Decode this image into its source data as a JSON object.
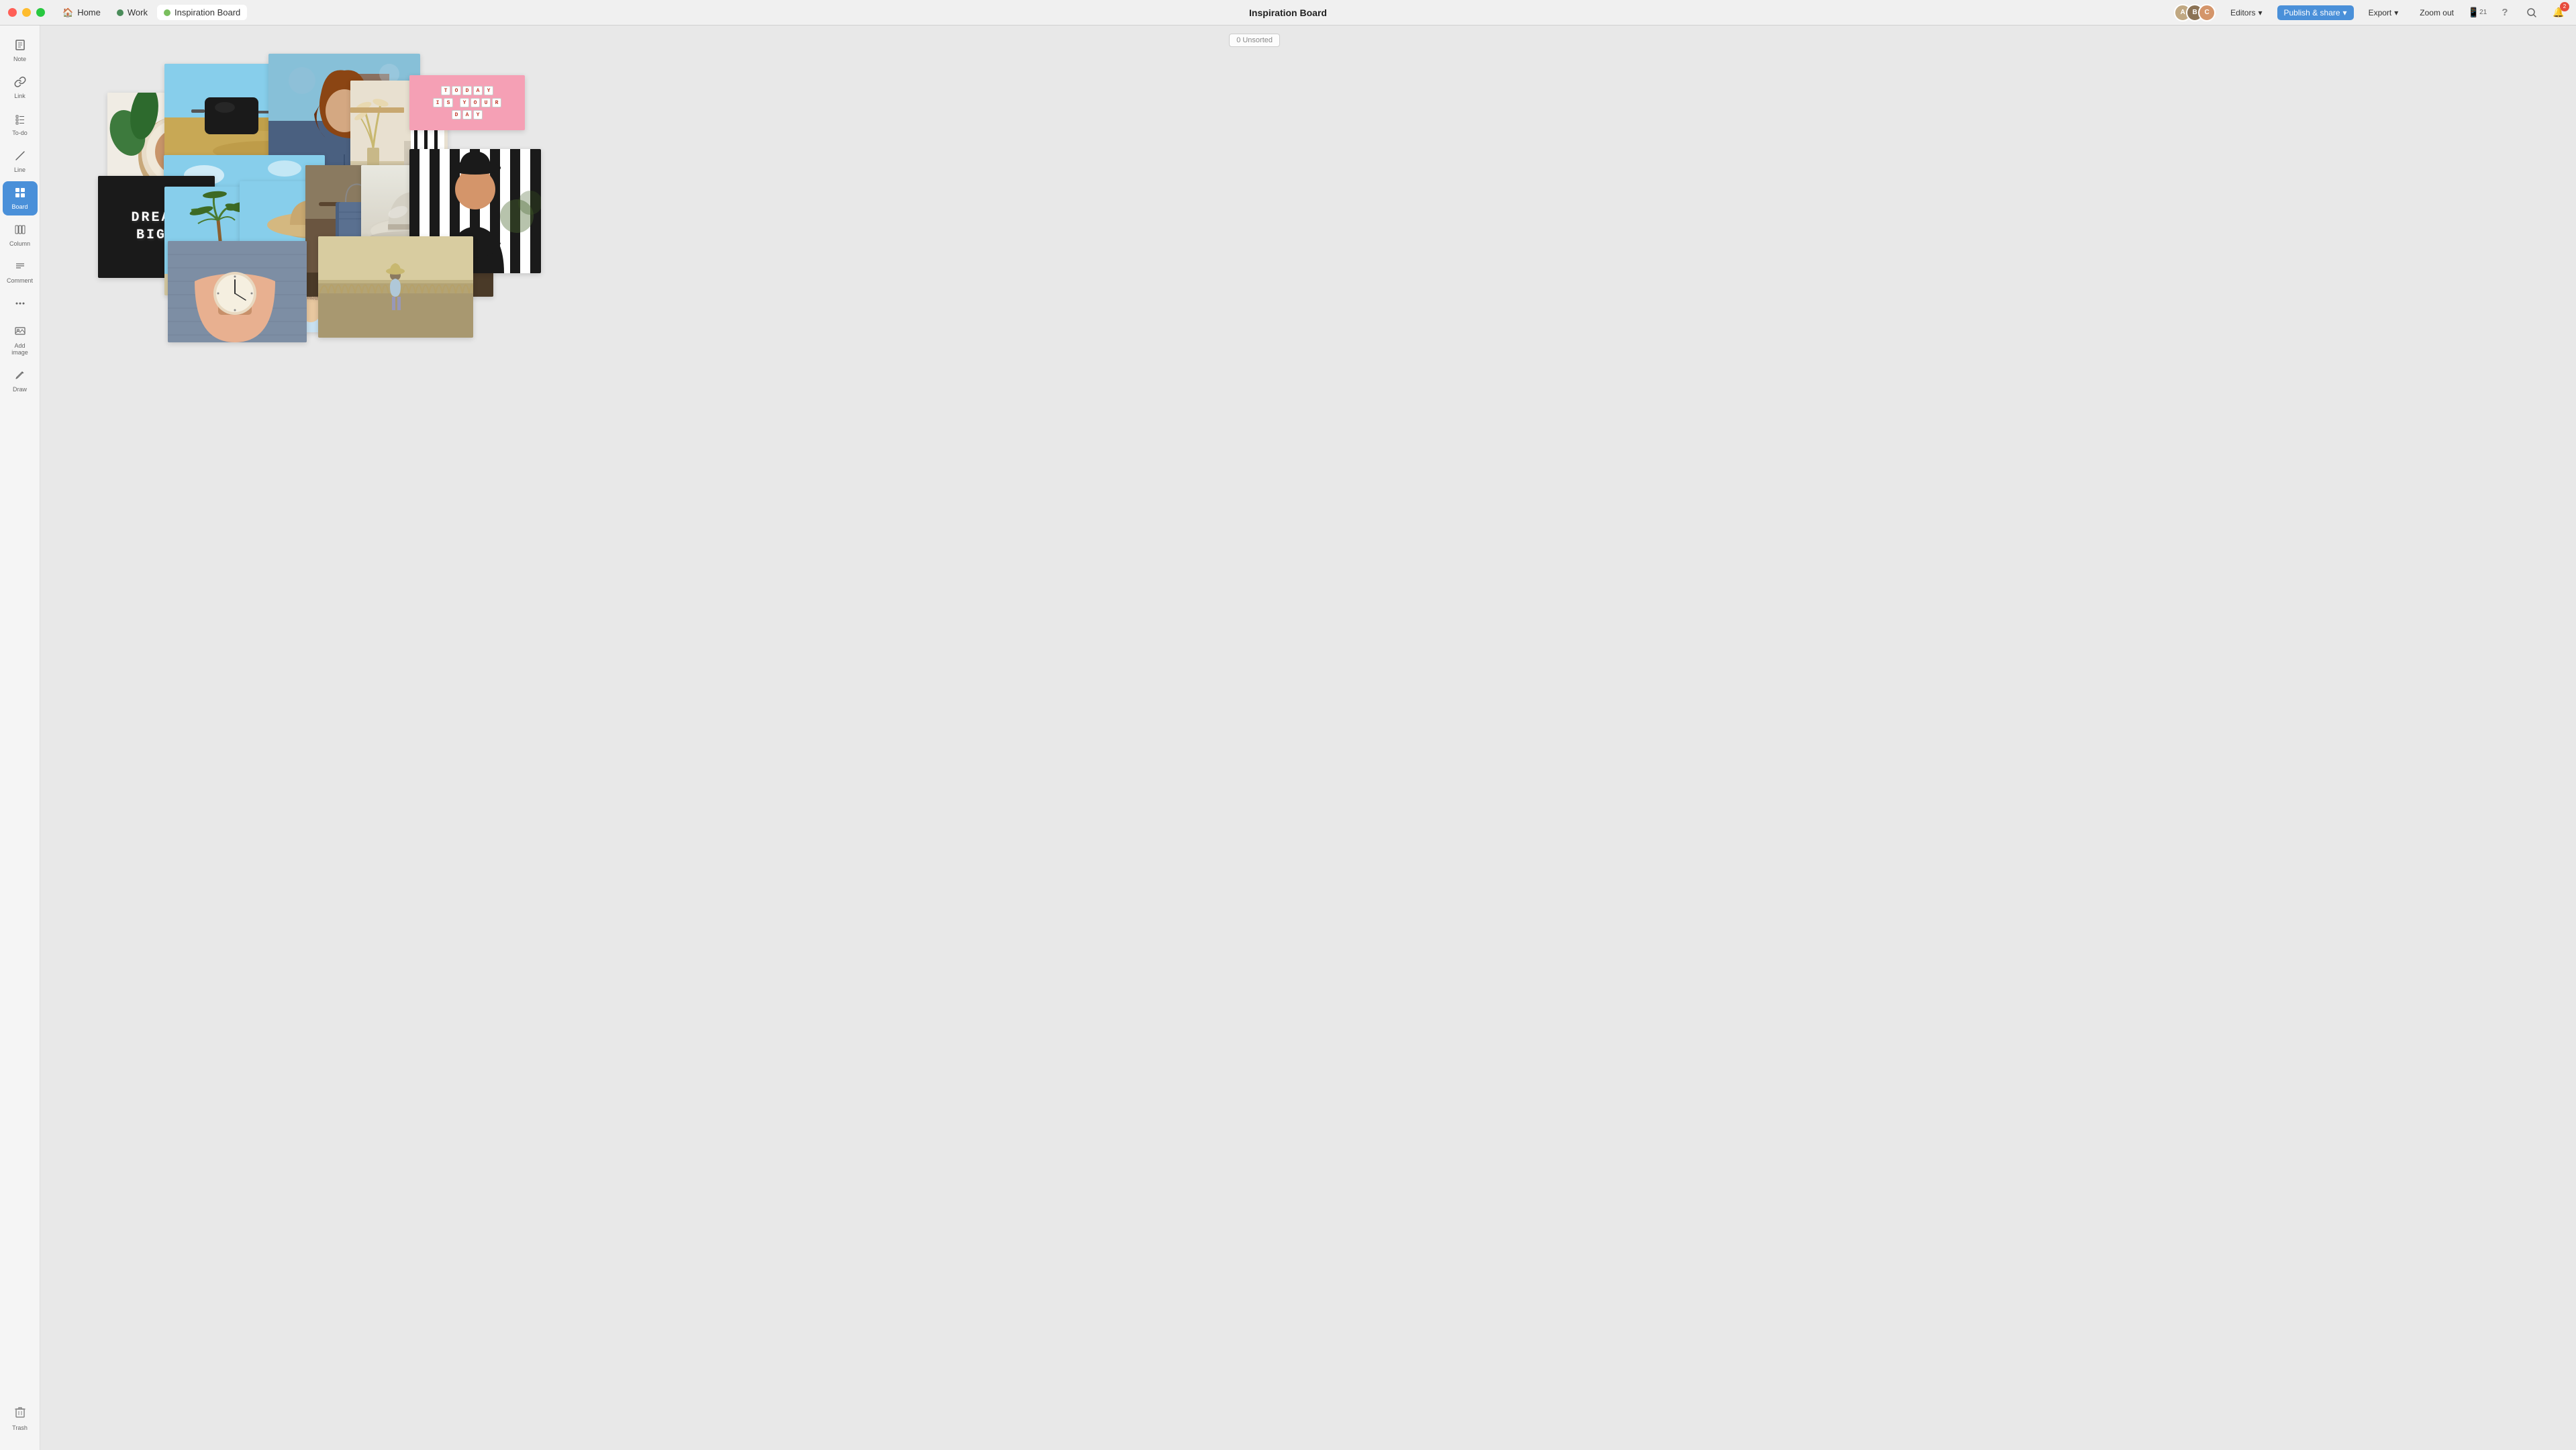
{
  "titlebar": {
    "title": "Inspiration Board",
    "tabs": [
      {
        "id": "home",
        "label": "Home",
        "icon_color": "#888",
        "active": false
      },
      {
        "id": "work",
        "label": "Work",
        "icon_color": "#4a8c5a",
        "active": false
      },
      {
        "id": "inspiration",
        "label": "Inspiration Board",
        "icon_color": "#7abf5e",
        "active": true
      }
    ],
    "right_buttons": [
      {
        "id": "device",
        "icon": "📱",
        "count": "21"
      },
      {
        "id": "help",
        "icon": "?"
      },
      {
        "id": "search",
        "icon": "🔍"
      },
      {
        "id": "notifications",
        "icon": "🔔",
        "badge": "2"
      }
    ],
    "editors_label": "Editors",
    "publish_label": "Publish & share",
    "export_label": "Export",
    "zoom_label": "Zoom out"
  },
  "sidebar": {
    "items": [
      {
        "id": "note",
        "icon": "☰",
        "label": "Note"
      },
      {
        "id": "link",
        "icon": "🔗",
        "label": "Link"
      },
      {
        "id": "todo",
        "icon": "≡",
        "label": "To-do"
      },
      {
        "id": "line",
        "icon": "/",
        "label": "Line"
      },
      {
        "id": "board",
        "icon": "⊞",
        "label": "Board",
        "active": true
      },
      {
        "id": "column",
        "icon": "⊟",
        "label": "Column"
      },
      {
        "id": "comment",
        "icon": "≡≡",
        "label": "Comment"
      },
      {
        "id": "more",
        "icon": "•••",
        "label": ""
      },
      {
        "id": "add-image",
        "icon": "🖼",
        "label": "Add image"
      },
      {
        "id": "draw",
        "icon": "✏",
        "label": "Draw"
      }
    ],
    "trash_label": "Trash"
  },
  "canvas": {
    "unsorted_label": "0 Unsorted"
  },
  "today_card": {
    "rows": [
      "TODAY",
      "IS YOUR",
      "DAY"
    ]
  },
  "dream_big": {
    "text": "DREAM\nBIG."
  }
}
